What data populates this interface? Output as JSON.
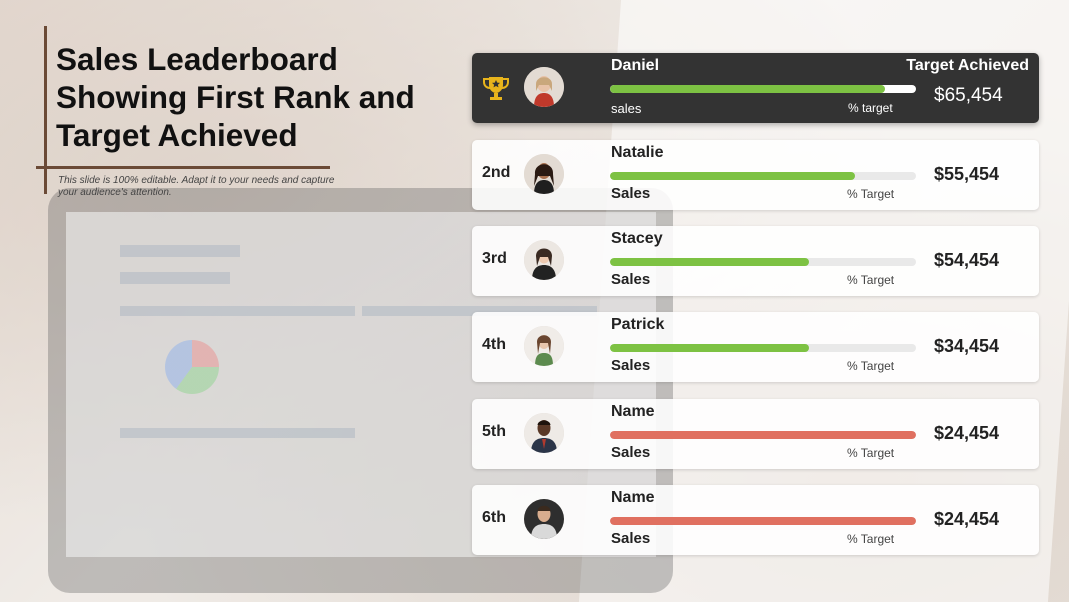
{
  "slide": {
    "title": "Sales Leaderboard Showing First Rank and Target Achieved",
    "subtitle": "This slide is 100% editable. Adapt it to your needs and capture your audience's attention."
  },
  "leader": {
    "name": "Daniel",
    "badge": "Target Achieved",
    "sales_label": "sales",
    "pct_label": "% target",
    "amount": "$65,454",
    "progress": 0.9,
    "bar_color": "#7dc243",
    "icon": "trophy-icon"
  },
  "rows": [
    {
      "rank": "2nd",
      "name": "Natalie",
      "sales_label": "Sales",
      "pct_label": "% Target",
      "amount": "$55,454",
      "progress": 0.8,
      "bar_color": "#7dc243"
    },
    {
      "rank": "3rd",
      "name": "Stacey",
      "sales_label": "Sales",
      "pct_label": "% Target",
      "amount": "$54,454",
      "progress": 0.65,
      "bar_color": "#7dc243"
    },
    {
      "rank": "4th",
      "name": "Patrick",
      "sales_label": "Sales",
      "pct_label": "% Target",
      "amount": "$34,454",
      "progress": 0.65,
      "bar_color": "#7dc243"
    },
    {
      "rank": "5th",
      "name": "Name",
      "sales_label": "Sales",
      "pct_label": "% Target",
      "amount": "$24,454",
      "progress": 1.0,
      "bar_color": "#e07060"
    },
    {
      "rank": "6th",
      "name": "Name",
      "sales_label": "Sales",
      "pct_label": "% Target",
      "amount": "$24,454",
      "progress": 1.0,
      "bar_color": "#e07060"
    }
  ],
  "colors": {
    "accent_brown": "#6b4a36",
    "leader_bg": "#333333",
    "trophy_gold": "#e8b41c"
  }
}
